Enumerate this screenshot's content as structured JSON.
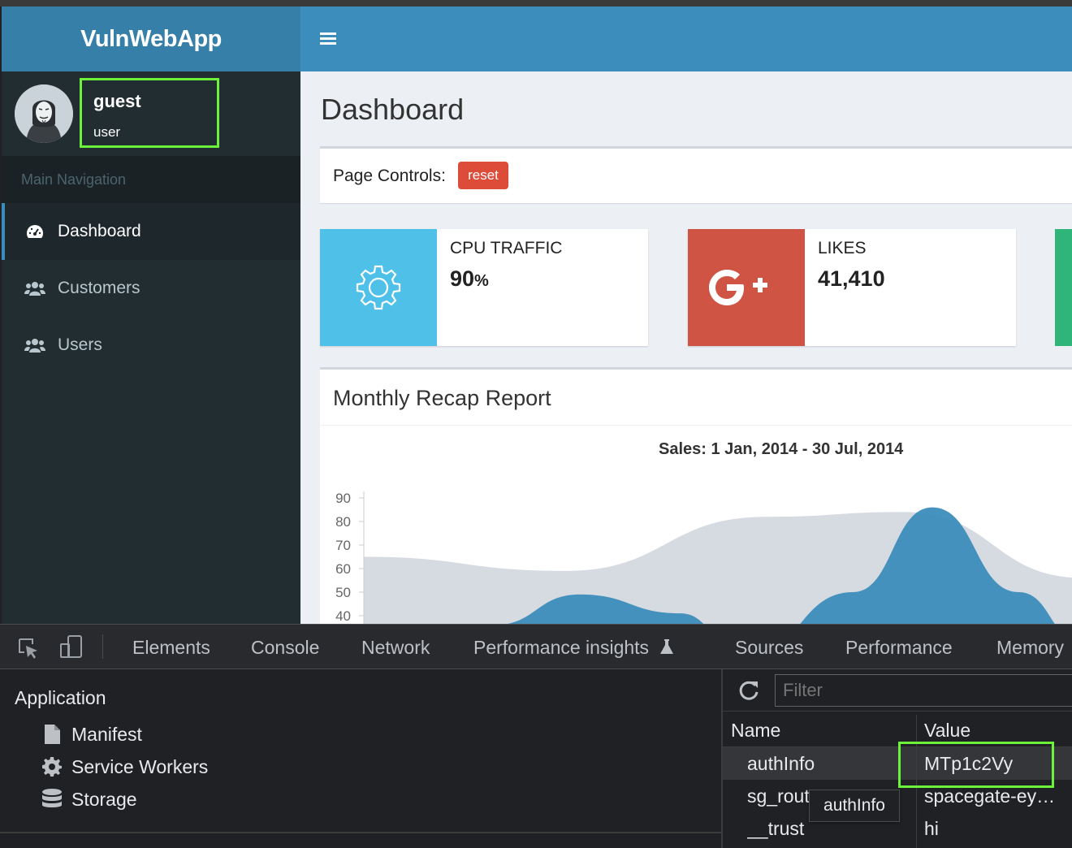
{
  "app": {
    "brand": "VulnWebApp"
  },
  "user": {
    "name": "guest",
    "role": "user"
  },
  "sidebar": {
    "header": "Main Navigation",
    "items": [
      {
        "label": "Dashboard",
        "icon": "dashboard-icon",
        "active": true
      },
      {
        "label": "Customers",
        "icon": "users-icon"
      },
      {
        "label": "Users",
        "icon": "users-icon"
      }
    ]
  },
  "main": {
    "title": "Dashboard",
    "controls": {
      "label": "Page Controls:",
      "reset": "reset"
    },
    "info_boxes": [
      {
        "label": "CPU TRAFFIC",
        "value": "90",
        "unit": "%",
        "color": "#4fc0e8",
        "icon": "gear-icon"
      },
      {
        "label": "LIKES",
        "value": "41,410",
        "color": "#d05443",
        "icon": "google-plus-icon"
      }
    ],
    "report": {
      "title": "Monthly Recap Report"
    }
  },
  "chart_data": {
    "type": "area",
    "title": "Sales: 1 Jan, 2014 - 30 Jul, 2014",
    "y_ticks": [
      40,
      50,
      60,
      70,
      80,
      90
    ],
    "series": [
      {
        "color": "#d2d6de",
        "points": [
          [
            0,
            65
          ],
          [
            0.28,
            59
          ],
          [
            0.56,
            82
          ],
          [
            0.75,
            84
          ],
          [
            1.0,
            56
          ]
        ]
      },
      {
        "color": "#3c8dbc",
        "points": [
          [
            0,
            20
          ],
          [
            0.18,
            36
          ],
          [
            0.3,
            49
          ],
          [
            0.44,
            41
          ],
          [
            0.53,
            22
          ],
          [
            0.68,
            50
          ],
          [
            0.79,
            86
          ],
          [
            0.91,
            50
          ],
          [
            1.0,
            28
          ]
        ]
      }
    ]
  },
  "devtools": {
    "tabs": [
      "Elements",
      "Console",
      "Network",
      "Performance insights",
      "Sources",
      "Performance",
      "Memory"
    ],
    "application": {
      "header": "Application",
      "items": [
        {
          "label": "Manifest",
          "icon": "file-icon"
        },
        {
          "label": "Service Workers",
          "icon": "gear-icon"
        },
        {
          "label": "Storage",
          "icon": "database-icon"
        }
      ]
    },
    "storage_table": {
      "filter_placeholder": "Filter",
      "columns": [
        "Name",
        "Value"
      ],
      "rows": [
        {
          "name": "authInfo",
          "value": "MTp1c2Vy"
        },
        {
          "name": "sg_rout",
          "value": "spacegate-ey…"
        },
        {
          "name": "__trust",
          "value": "hi"
        }
      ],
      "tooltip": "authInfo"
    }
  }
}
